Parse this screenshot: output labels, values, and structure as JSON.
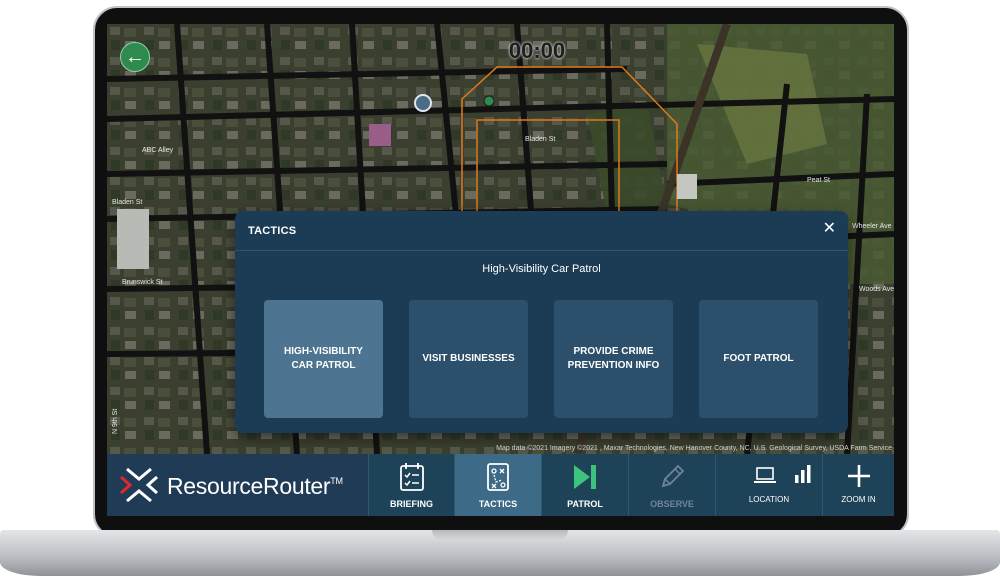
{
  "map": {
    "timer": "00:00",
    "attribution": "Map data ©2021 Imagery ©2021 , Maxar Technologies, New Hanover County, NC, U.S. Geological Survey, USDA Farm Service",
    "street_labels": [
      "ABC Alley",
      "Bladen St",
      "Bladen St",
      "Brunswick St",
      "Peat St",
      "Wheeler Ave",
      "Woods Ave",
      "N 9th St"
    ]
  },
  "modal": {
    "title": "TACTICS",
    "subtitle": "High-Visibility Car Patrol",
    "options": [
      {
        "label": "HIGH-VISIBILITY CAR PATROL",
        "selected": true
      },
      {
        "label": "VISIT BUSINESSES",
        "selected": false
      },
      {
        "label": "PROVIDE CRIME PREVENTION INFO",
        "selected": false
      },
      {
        "label": "FOOT PATROL",
        "selected": false
      }
    ]
  },
  "toolbar": {
    "brand": "ResourceRouter",
    "trademark": "TM",
    "briefing_label": "BRIEFING",
    "tactics_label": "TACTICS",
    "patrol_label": "PATROL",
    "observe_label": "OBSERVE",
    "location_label": "LOCATION",
    "zoom_label": "ZOOM IN"
  },
  "colors": {
    "modal_bg": "#1c3c55",
    "selected_tactic": "#4d7491",
    "tactic_bg": "#2c506b",
    "toolbar_bg": "#1e4359",
    "patrol_accent": "#3cc47c",
    "logo_accent_red": "#e0282e",
    "zone_outline": "#e07a1c"
  },
  "icons": [
    "back-arrow-icon",
    "close-icon",
    "checklist-icon",
    "tactics-board-icon",
    "play-end-icon",
    "pencil-icon",
    "laptop-icon",
    "signal-bars-icon",
    "plus-icon",
    "resource-router-logo-icon"
  ]
}
